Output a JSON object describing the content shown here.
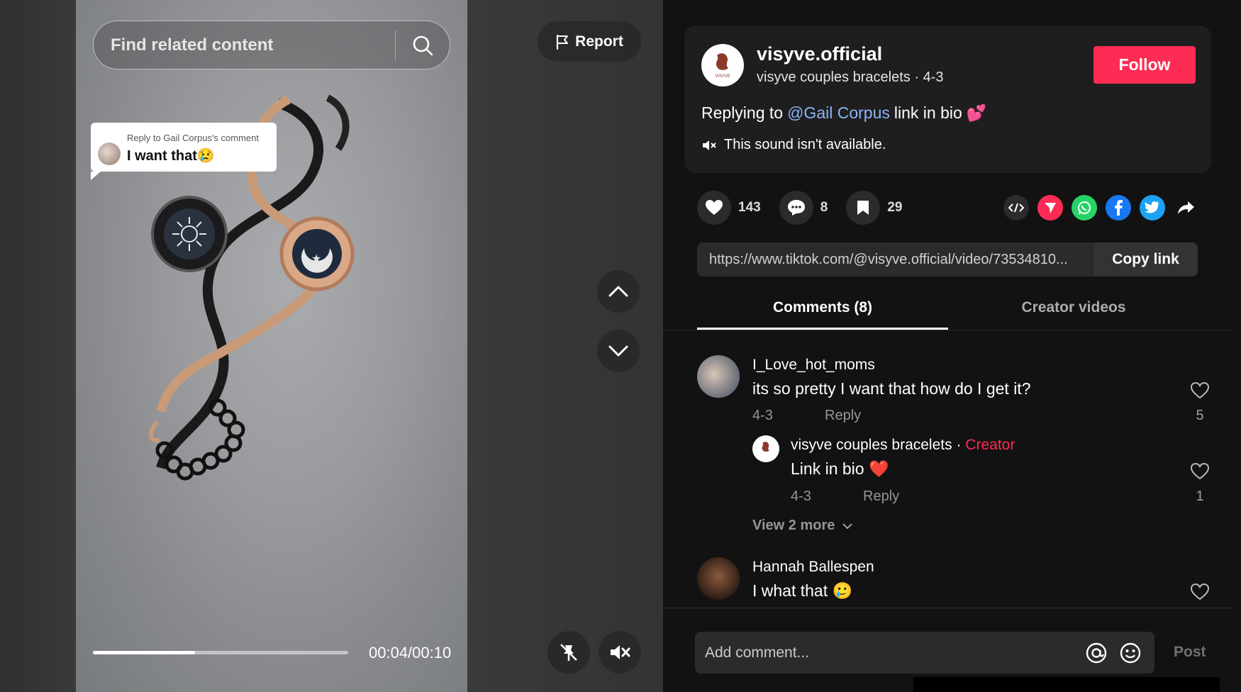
{
  "video": {
    "search_placeholder": "Find related content",
    "report_label": "Report",
    "reply_bubble": {
      "header": "Reply to Gail Corpus's comment",
      "text": "I want that😢"
    },
    "progress": {
      "fraction": 0.4,
      "time_label": "00:04/00:10"
    }
  },
  "post": {
    "username": "visyve.official",
    "display_name": "visyve couples bracelets",
    "date": "4-3",
    "follow_label": "Follow",
    "caption_prefix": "Replying to",
    "caption_mention": "@Gail Corpus",
    "caption_suffix": "link in bio",
    "caption_emoji": "💕",
    "sound_text": "This sound isn't available.",
    "avatar_text": "VISYVE"
  },
  "stats": {
    "likes": "143",
    "comments": "8",
    "saves": "29"
  },
  "share": {
    "link": "https://www.tiktok.com/@visyve.official/video/73534810...",
    "copy_label": "Copy link",
    "colors": {
      "send": "#fe2c55",
      "whatsapp": "#25d366",
      "facebook": "#1877f2",
      "twitter": "#1da1f2"
    }
  },
  "tabs": {
    "comments": "Comments (8)",
    "creator": "Creator videos"
  },
  "comments": [
    {
      "name": "I_Love_hot_moms",
      "text": "its so pretty I want that how do I get it?",
      "date": "4-3",
      "reply_label": "Reply",
      "likes": "5",
      "replies": [
        {
          "name": "visyve couples bracelets",
          "separator": "·",
          "tag": "Creator",
          "text": "Link in bio",
          "emoji": "❤️",
          "date": "4-3",
          "reply_label": "Reply",
          "likes": "1"
        }
      ],
      "view_more": "View 2 more"
    },
    {
      "name": "Hannah Ballespen",
      "text": "I what that 🥲"
    }
  ],
  "composer": {
    "placeholder": "Add comment...",
    "post_label": "Post"
  }
}
